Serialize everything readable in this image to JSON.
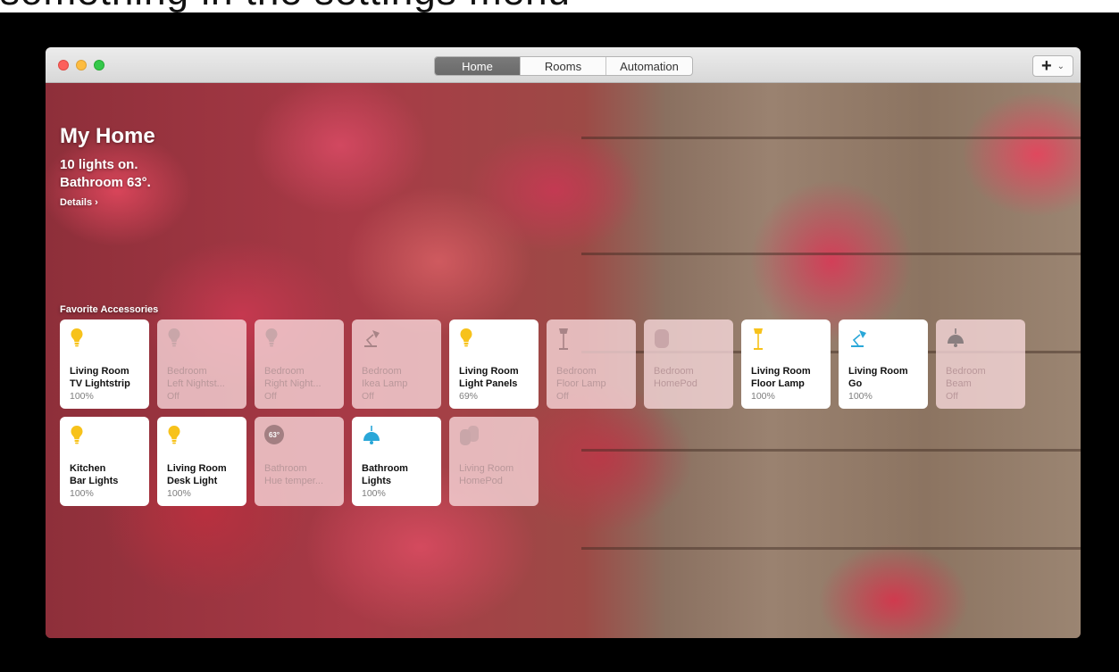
{
  "caption": "something in the settings menu",
  "titlebar": {
    "tabs": [
      {
        "label": "Home",
        "active": true
      },
      {
        "label": "Rooms",
        "active": false
      },
      {
        "label": "Automation",
        "active": false
      }
    ],
    "add_label": "+",
    "add_chevron": "⌄"
  },
  "home": {
    "title": "My Home",
    "status_line1": "10 lights on.",
    "status_line2": "Bathroom 63°.",
    "details": "Details ›",
    "favorites_label": "Favorite Accessories"
  },
  "accessories": [
    {
      "line1": "Living Room",
      "line2": "TV Lightstrip",
      "state": "100%",
      "on": true,
      "icon": "lightbulb-icon",
      "icon_color": "#f7c21b"
    },
    {
      "line1": "Bedroom",
      "line2": "Left Nightst...",
      "state": "Off",
      "on": false,
      "icon": "lightbulb-icon",
      "icon_color": "#c9a6a9"
    },
    {
      "line1": "Bedroom",
      "line2": "Right Night...",
      "state": "Off",
      "on": false,
      "icon": "lightbulb-icon",
      "icon_color": "#c9a6a9"
    },
    {
      "line1": "Bedroom",
      "line2": "Ikea Lamp",
      "state": "Off",
      "on": false,
      "icon": "desk-lamp-icon",
      "icon_color": "#a88487"
    },
    {
      "line1": "Living Room",
      "line2": "Light Panels",
      "state": "69%",
      "on": true,
      "icon": "lightbulb-icon",
      "icon_color": "#f7c21b"
    },
    {
      "line1": "Bedroom",
      "line2": "Floor Lamp",
      "state": "Off",
      "on": false,
      "icon": "floor-lamp-icon",
      "icon_color": "#a88487"
    },
    {
      "line1": "Bedroom",
      "line2": "HomePod",
      "state": "",
      "on": false,
      "icon": "homepod-icon",
      "icon_color": "#c9a6a9"
    },
    {
      "line1": "Living Room",
      "line2": "Floor Lamp",
      "state": "100%",
      "on": true,
      "icon": "floor-lamp-icon",
      "icon_color": "#f7c21b"
    },
    {
      "line1": "Living Room",
      "line2": "Go",
      "state": "100%",
      "on": true,
      "icon": "desk-lamp-icon",
      "icon_color": "#2aa7d8"
    },
    {
      "line1": "Bedroom",
      "line2": "Beam",
      "state": "Off",
      "on": false,
      "icon": "pendant-light-icon",
      "icon_color": "#8a7f80"
    },
    {
      "line1": "Kitchen",
      "line2": "Bar Lights",
      "state": "100%",
      "on": true,
      "icon": "lightbulb-icon",
      "icon_color": "#f7c21b"
    },
    {
      "line1": "Living Room",
      "line2": "Desk Light",
      "state": "100%",
      "on": true,
      "icon": "lightbulb-icon",
      "icon_color": "#f7c21b"
    },
    {
      "line1": "Bathroom",
      "line2": "Hue temper...",
      "state": "",
      "on": false,
      "icon": "temperature-badge-icon",
      "icon_color": "#a37f82",
      "badge": "63°"
    },
    {
      "line1": "Bathroom",
      "line2": "Lights",
      "state": "100%",
      "on": true,
      "icon": "pendant-light-icon",
      "icon_color": "#2aa7d8"
    },
    {
      "line1": "Living Room",
      "line2": "HomePod",
      "state": "",
      "on": false,
      "icon": "homepods-icon",
      "icon_color": "#c9a6a9"
    }
  ]
}
